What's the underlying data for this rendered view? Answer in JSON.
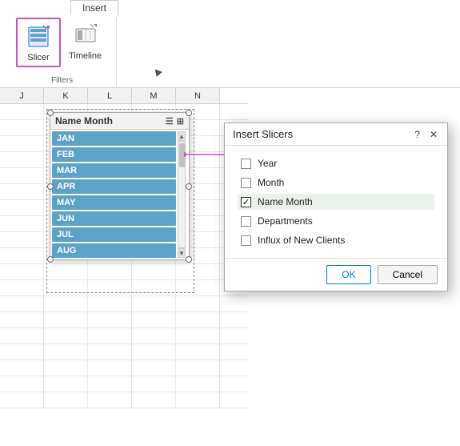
{
  "ribbon": {
    "tab": "Insert",
    "slicer_label": "Slicer",
    "timeline_label": "Timeline",
    "group_label": "Filters"
  },
  "slicer": {
    "title": "Name Month",
    "items": [
      "JAN",
      "FEB",
      "MAR",
      "APR",
      "MAY",
      "JUN",
      "JUL",
      "AUG"
    ]
  },
  "grid": {
    "columns": [
      "J",
      "K",
      "L",
      "M",
      "N"
    ],
    "rows": 20
  },
  "dialog": {
    "title": "Insert Slicers",
    "help_btn": "?",
    "close_btn": "✕",
    "fields": [
      {
        "label": "Year",
        "checked": false
      },
      {
        "label": "Month",
        "checked": false
      },
      {
        "label": "Name Month",
        "checked": true
      },
      {
        "label": "Departments",
        "checked": false
      },
      {
        "label": "Influx of New Clients",
        "checked": false
      }
    ],
    "ok_label": "OK",
    "cancel_label": "Cancel"
  }
}
